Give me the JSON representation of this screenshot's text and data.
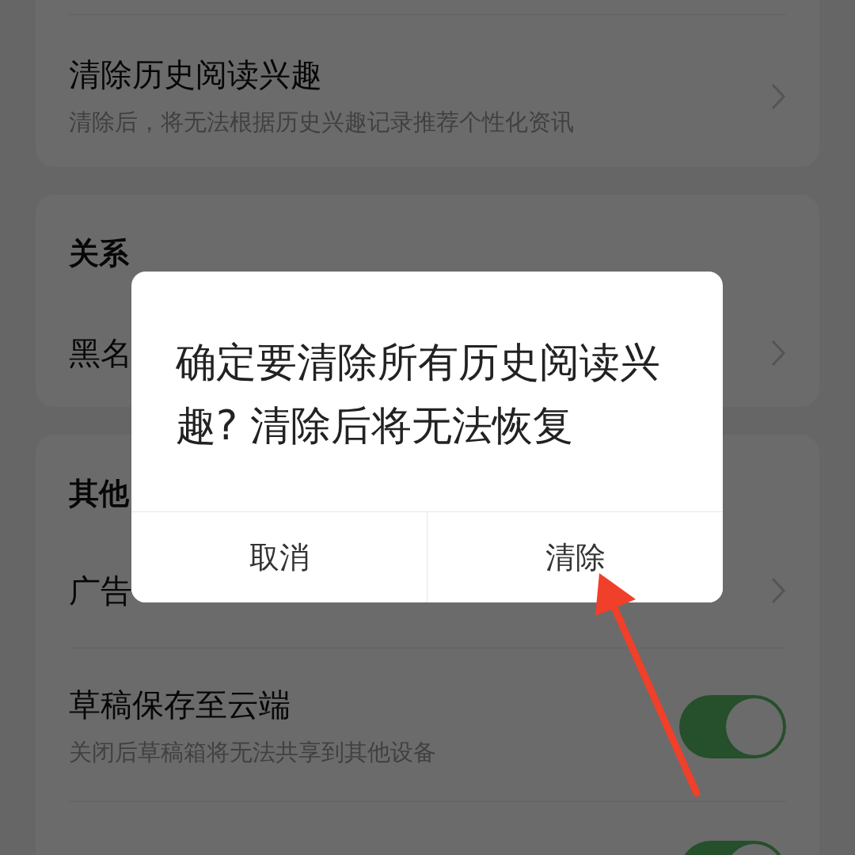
{
  "cards": [
    {
      "rows": [
        {
          "kind": "nav",
          "title": "清除历史阅读兴趣",
          "subtitle": "清除后，将无法根据历史兴趣记录推荐个性化资讯"
        }
      ]
    },
    {
      "header": "关系",
      "rows": [
        {
          "kind": "nav",
          "title": "黑名"
        }
      ]
    },
    {
      "header": "其他",
      "rows": [
        {
          "kind": "nav",
          "title": "广告"
        },
        {
          "kind": "toggle",
          "title": "草稿保存至云端",
          "subtitle": "关闭后草稿箱将无法共享到其他设备",
          "on": true
        },
        {
          "kind": "toggle",
          "on": true
        }
      ]
    }
  ],
  "dialog": {
    "message": "确定要清除所有历史阅读兴趣? 清除后将无法恢复",
    "buttons": [
      {
        "label": "取消"
      },
      {
        "label": "清除"
      }
    ]
  }
}
